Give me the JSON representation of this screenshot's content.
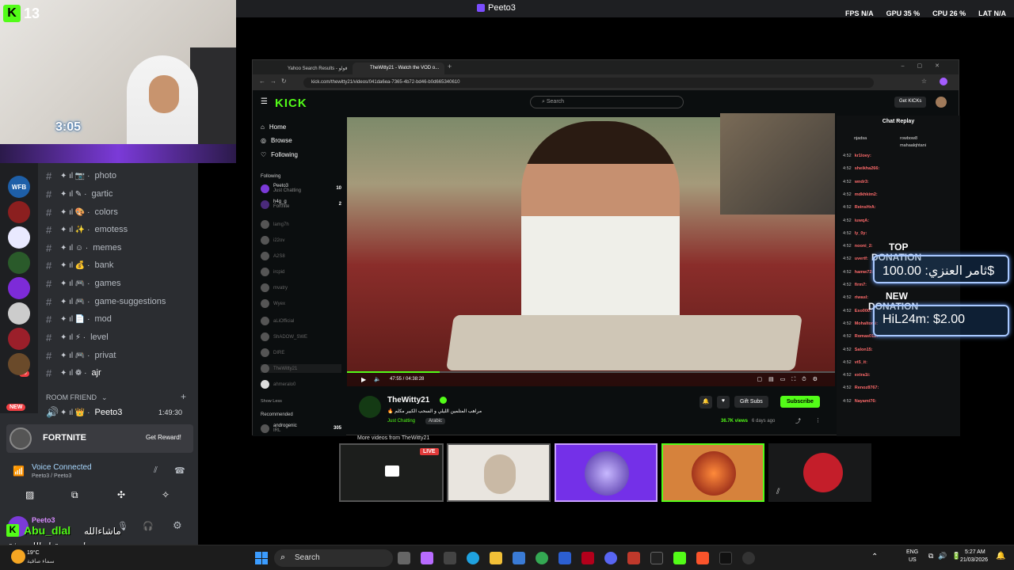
{
  "topbar": {
    "title": "Peeto3",
    "fps_label": "FPS",
    "fps": "N/A",
    "gpu_label": "GPU",
    "gpu": "35 %",
    "cpu_label": "CPU",
    "cpu": "26 %",
    "lat_label": "LAT",
    "lat": "N/A"
  },
  "webcam": {
    "kick_number": "13",
    "clock_overlay": "3:05"
  },
  "discord": {
    "channels": [
      {
        "name": "photo"
      },
      {
        "name": "gartic"
      },
      {
        "name": "colors"
      },
      {
        "name": "emotess"
      },
      {
        "name": "memes"
      },
      {
        "name": "bank"
      },
      {
        "name": "games"
      },
      {
        "name": "game-suggestions"
      },
      {
        "name": "mod"
      },
      {
        "name": "level"
      },
      {
        "name": "privat"
      },
      {
        "name": "ajr"
      }
    ],
    "category": "ROOM FRIEND",
    "voice_channel": "Peeto3",
    "voice_time": "1:49:30",
    "new_badge": "NEW",
    "guild_labels": {
      "wfb": "WFB",
      "badge1": "50",
      "badge2": "3"
    },
    "fortnite": {
      "title": "FORTNITE",
      "button": "Get Reward!"
    },
    "voice": {
      "status": "Voice Connected",
      "where": "Peeto3 / Peeto3"
    },
    "user": {
      "name": "Peeto3",
      "overlay_name": "Abu_dlal",
      "message": "ماشاءالله",
      "message2": "وراه مستقبل الله يوفقه",
      "weather_temp": "19°C",
      "weather_desc": "سماء صافية"
    }
  },
  "browser": {
    "tabs": [
      {
        "label": "Yahoo Search Results - فولو"
      },
      {
        "label": "TheWitty21 - Watch the VOD o..."
      }
    ],
    "url": "kick.com/thewitty21/videos/041da6ea-7365-4b72-bd46-b0d665340610",
    "search_placeholder": "Search",
    "get_kicks": "Get KICKs",
    "nav": {
      "home": "Home",
      "browse": "Browse",
      "following": "Following",
      "following_header": "Following",
      "show_less": "Show Less",
      "recommended": "Recommended"
    },
    "following": [
      {
        "name": "Peeto3",
        "sub": "Just Chatting",
        "count": "10"
      },
      {
        "name": "h4g_g",
        "sub": "Fortnite",
        "count": "2"
      },
      {
        "name": "lamg7h",
        "sub": "",
        "count": ""
      },
      {
        "name": "i22ov",
        "sub": "",
        "count": ""
      },
      {
        "name": "A2S8",
        "sub": "",
        "count": ""
      },
      {
        "name": "ircpid",
        "sub": "",
        "count": ""
      },
      {
        "name": "mvatry",
        "sub": "",
        "count": ""
      },
      {
        "name": "Wyex",
        "sub": "",
        "count": ""
      },
      {
        "name": "aLiOfficial",
        "sub": "",
        "count": ""
      },
      {
        "name": "ShADOW_SWE",
        "sub": "",
        "count": ""
      },
      {
        "name": "DIRE",
        "sub": "",
        "count": ""
      },
      {
        "name": "TheWitty21",
        "sub": "",
        "count": ""
      },
      {
        "name": "ahmeralo0",
        "sub": "",
        "count": ""
      }
    ],
    "recommended": [
      {
        "name": "androgenic",
        "sub": "IRL",
        "count": "305"
      }
    ],
    "video": {
      "time": "47:55 / 04:38:28",
      "progress": 0.19
    },
    "stream": {
      "streamer": "TheWitty21",
      "title": "🔥 مراهب المتلمين الليلي و السحب الكبير مكلم",
      "category": "Just Chatting",
      "language": "Arabic",
      "gift": "Gift Subs",
      "subscribe": "Subscribe",
      "views": "36.7K views",
      "ago": "6 days ago",
      "more": "More videos from TheWitty21"
    },
    "chat": {
      "header": "Chat Replay",
      "top": [
        "njadsa",
        "rowbow8",
        "mahaalqhtani"
      ],
      "messages": [
        {
          "time": "4:52",
          "user": "kr1loey:",
          "text": ""
        },
        {
          "time": "4:52",
          "user": "sheikha266:",
          "text": ""
        },
        {
          "time": "4:52",
          "user": "wndr3:",
          "text": ""
        },
        {
          "time": "4:52",
          "user": "mdkhkim2:",
          "text": ""
        },
        {
          "time": "4:52",
          "user": "ReinsHrA:",
          "text": ""
        },
        {
          "time": "4:52",
          "user": "iuwqA:",
          "text": ""
        },
        {
          "time": "4:52",
          "user": "ly_0y:",
          "text": ""
        },
        {
          "time": "4:52",
          "user": "nooni_2:",
          "text": ""
        },
        {
          "time": "4:52",
          "user": "uvertf:",
          "text": ""
        },
        {
          "time": "4:52",
          "user": "hamw72:",
          "text": ""
        },
        {
          "time": "4:52",
          "user": "firm7:",
          "text": ""
        },
        {
          "time": "4:52",
          "user": "riwasl:",
          "text": ""
        },
        {
          "time": "4:52",
          "user": "Eso000:",
          "text": ""
        },
        {
          "time": "4:52",
          "user": "Mohaltomi:",
          "text": ""
        },
        {
          "time": "4:52",
          "user": "Romas012:",
          "text": ""
        },
        {
          "time": "4:52",
          "user": "Salon15:",
          "text": ""
        },
        {
          "time": "4:52",
          "user": "vt5_it:",
          "text": ""
        },
        {
          "time": "4:52",
          "user": "extra1t:",
          "text": ""
        },
        {
          "time": "4:52",
          "user": "Renoz8767:",
          "text": ""
        },
        {
          "time": "4:52",
          "user": "Nayami76:",
          "text": ""
        }
      ]
    }
  },
  "donations": {
    "top_label1": "TOP",
    "top_label2": "DONATION",
    "top_value": "ثامر العنزي: 100.00$",
    "new_label1": "NEW",
    "new_label2": "DONATION",
    "new_value": "HiL24m: $2.00"
  },
  "thumbs": {
    "live": "LIVE"
  },
  "taskbar": {
    "search": "Search",
    "lang": "ENG",
    "region": "US",
    "time": "5:27 AM",
    "date": "21/03/2026"
  }
}
